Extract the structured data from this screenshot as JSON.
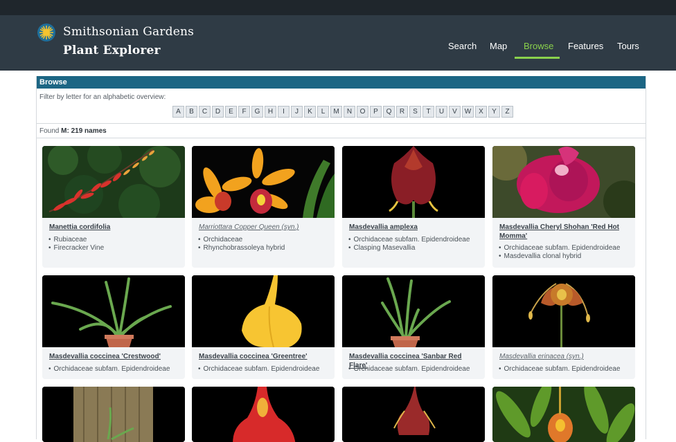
{
  "header": {
    "brand_line1": "Smithsonian Gardens",
    "brand_line2": "Plant Explorer",
    "nav": [
      "Search",
      "Map",
      "Browse",
      "Features",
      "Tours"
    ],
    "active": "Browse",
    "accent": "#8ad14c"
  },
  "browse": {
    "title": "Browse",
    "filter_label": "Filter by letter for an alphabetic overview:",
    "letters": [
      "A",
      "B",
      "C",
      "D",
      "E",
      "F",
      "G",
      "H",
      "I",
      "J",
      "K",
      "L",
      "M",
      "N",
      "O",
      "P",
      "Q",
      "R",
      "S",
      "T",
      "U",
      "V",
      "W",
      "X",
      "Y",
      "Z"
    ],
    "found_prefix": "Found",
    "found_value": "M: 219 names"
  },
  "cards": [
    {
      "title": "Manettia cordifolia",
      "syn": false,
      "lines": [
        "Rubiaceae",
        "Firecracker Vine"
      ]
    },
    {
      "title": "Marriottara Copper Queen (syn.)",
      "syn": true,
      "lines": [
        "Orchidaceae",
        "Rhynchobrassoleya hybrid"
      ]
    },
    {
      "title": "Masdevallia amplexa",
      "syn": false,
      "lines": [
        "Orchidaceae subfam. Epidendroideae",
        "Clasping Masevallia"
      ]
    },
    {
      "title": "Masdevallia Cheryl Shohan 'Red Hot Momma'",
      "syn": false,
      "lines": [
        "Orchidaceae subfam. Epidendroideae",
        "Masdevallia clonal hybrid"
      ]
    },
    {
      "title": "Masdevallia coccinea 'Crestwood'",
      "syn": false,
      "lines": [
        "Orchidaceae subfam. Epidendroideae"
      ]
    },
    {
      "title": "Masdevallia coccinea 'Greentree'",
      "syn": false,
      "lines": [
        "Orchidaceae subfam. Epidendroideae"
      ]
    },
    {
      "title": "Masdevallia coccinea 'Sanbar Red Flare'",
      "syn": false,
      "lines": [
        "Orchidaceae subfam. Epidendroideae"
      ]
    },
    {
      "title": "Masdevallia erinacea (syn.)",
      "syn": true,
      "lines": [
        "Orchidaceae subfam. Epidendroideae"
      ]
    }
  ]
}
